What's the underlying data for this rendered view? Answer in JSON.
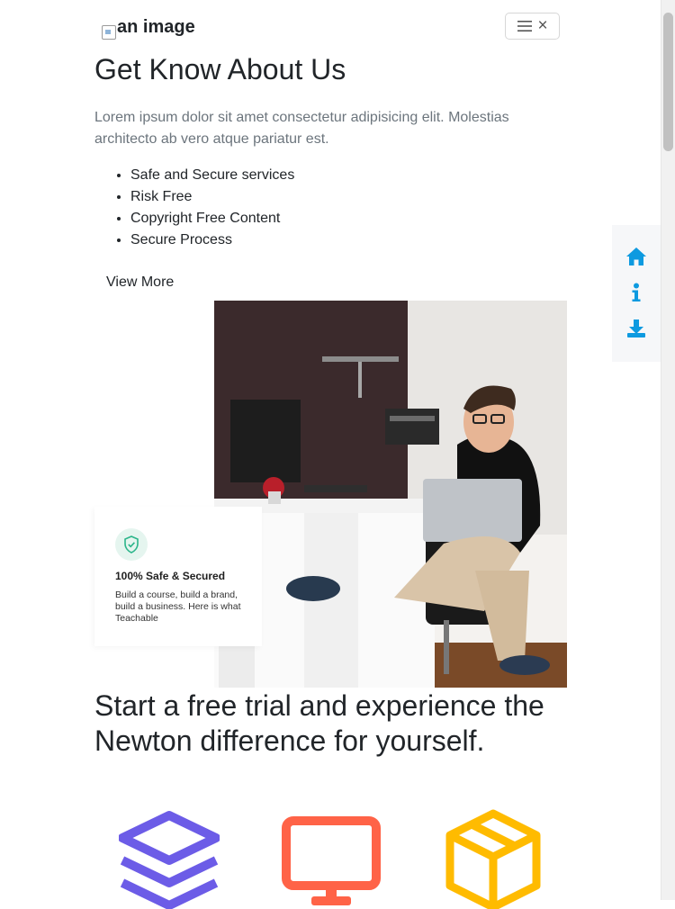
{
  "header": {
    "logo_alt": "an image",
    "menu_icon": "hamburger-icon",
    "close_icon": "close-icon",
    "close_glyph": "×"
  },
  "about": {
    "title": "Get Know About Us",
    "lead": "Lorem ipsum dolor sit amet consectetur adipisicing elit. Molestias architecto ab vero atque pariatur est.",
    "features": [
      "Safe and Secure services",
      "Risk Free",
      "Copyright Free Content",
      "Secure Process"
    ],
    "view_more": "View More"
  },
  "badge": {
    "icon": "shield-check-icon",
    "title": "100% Safe & Secured",
    "text": "Build a course, build a brand, build a business. Here is what Teachable"
  },
  "cta": {
    "title": "Start a free trial and experience the Newton difference for yourself."
  },
  "feature_icons": [
    {
      "icon": "layers-icon",
      "color": "#6c5ce7"
    },
    {
      "icon": "monitor-icon",
      "color": "#ff6347"
    },
    {
      "icon": "package-icon",
      "color": "#ffbb00"
    }
  ],
  "sidenav": {
    "items": [
      {
        "icon": "home-icon"
      },
      {
        "icon": "info-icon"
      },
      {
        "icon": "download-icon"
      }
    ],
    "color": "#0d9ae0"
  }
}
